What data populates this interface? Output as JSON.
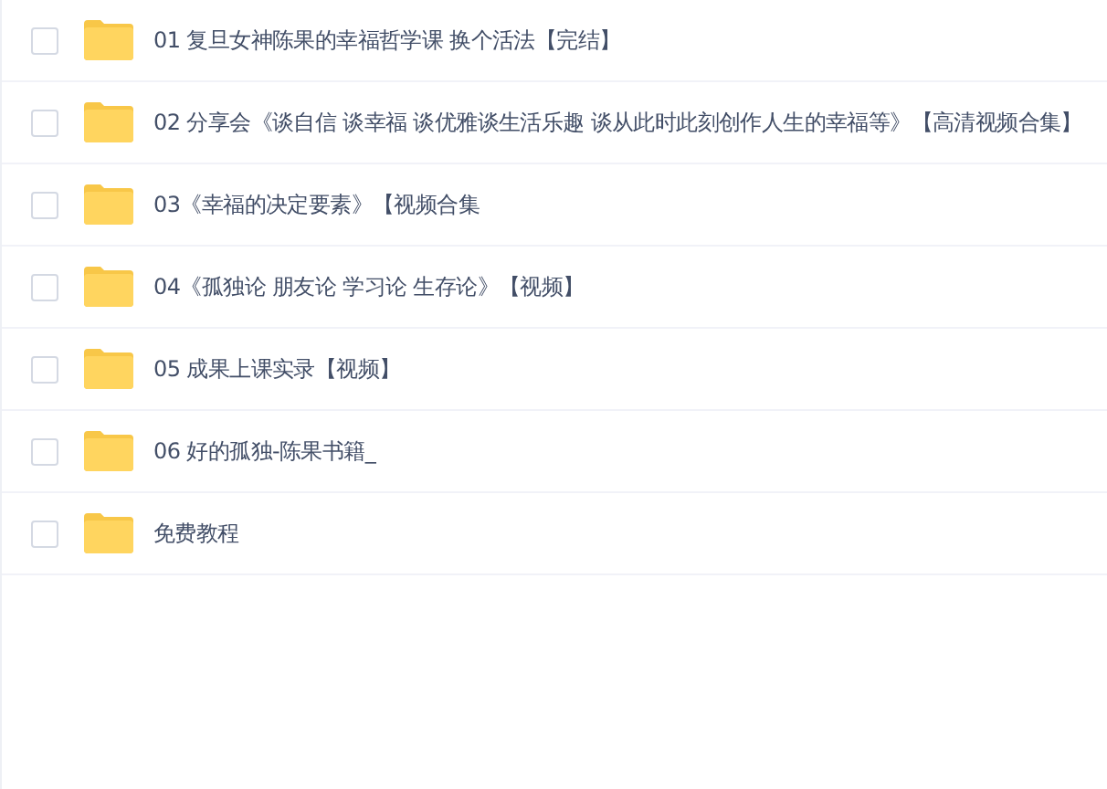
{
  "files": [
    {
      "name": "01 复旦女神陈果的幸福哲学课 换个活法【完结】",
      "checked": false
    },
    {
      "name": "02 分享会《谈自信 谈幸福 谈优雅谈生活乐趣 谈从此时此刻创作人生的幸福等》【高清视频合集】",
      "checked": false
    },
    {
      "name": "03《幸福的决定要素》【视频合集",
      "checked": false
    },
    {
      "name": "04《孤独论 朋友论 学习论 生存论》【视频】",
      "checked": false
    },
    {
      "name": "05 成果上课实录【视频】",
      "checked": false
    },
    {
      "name": "06 好的孤独-陈果书籍_",
      "checked": false
    },
    {
      "name": "免费教程",
      "checked": false
    }
  ]
}
